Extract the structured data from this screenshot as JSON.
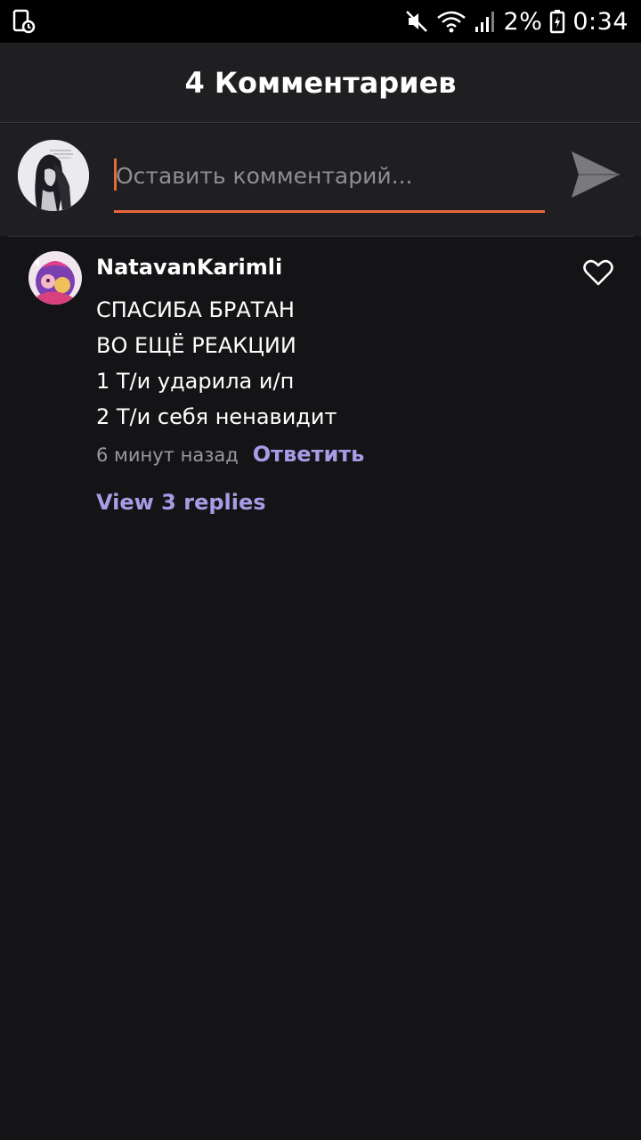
{
  "status_bar": {
    "battery_percent": "2%",
    "time": "0:34",
    "icons": [
      "screen-record-icon",
      "mute-icon",
      "wifi-icon",
      "signal-icon",
      "battery-charging-icon"
    ]
  },
  "header": {
    "title": "4 Комментариев"
  },
  "composer": {
    "placeholder": "Оставить комментарий...",
    "value": "",
    "accent_color": "#e8683b"
  },
  "comments": [
    {
      "author": "NatavanKarimli",
      "lines": [
        "СПАСИБА БРАТАН",
        "ВО ЕЩЁ РЕАКЦИИ",
        "1 Т/и ударила и/п",
        "2 Т/и себя ненавидит"
      ],
      "timestamp": "6 минут назад",
      "reply_label": "Ответить",
      "view_replies_label": "View 3 replies",
      "liked": false
    }
  ],
  "colors": {
    "background": "#141316",
    "link": "#a99ce6"
  }
}
